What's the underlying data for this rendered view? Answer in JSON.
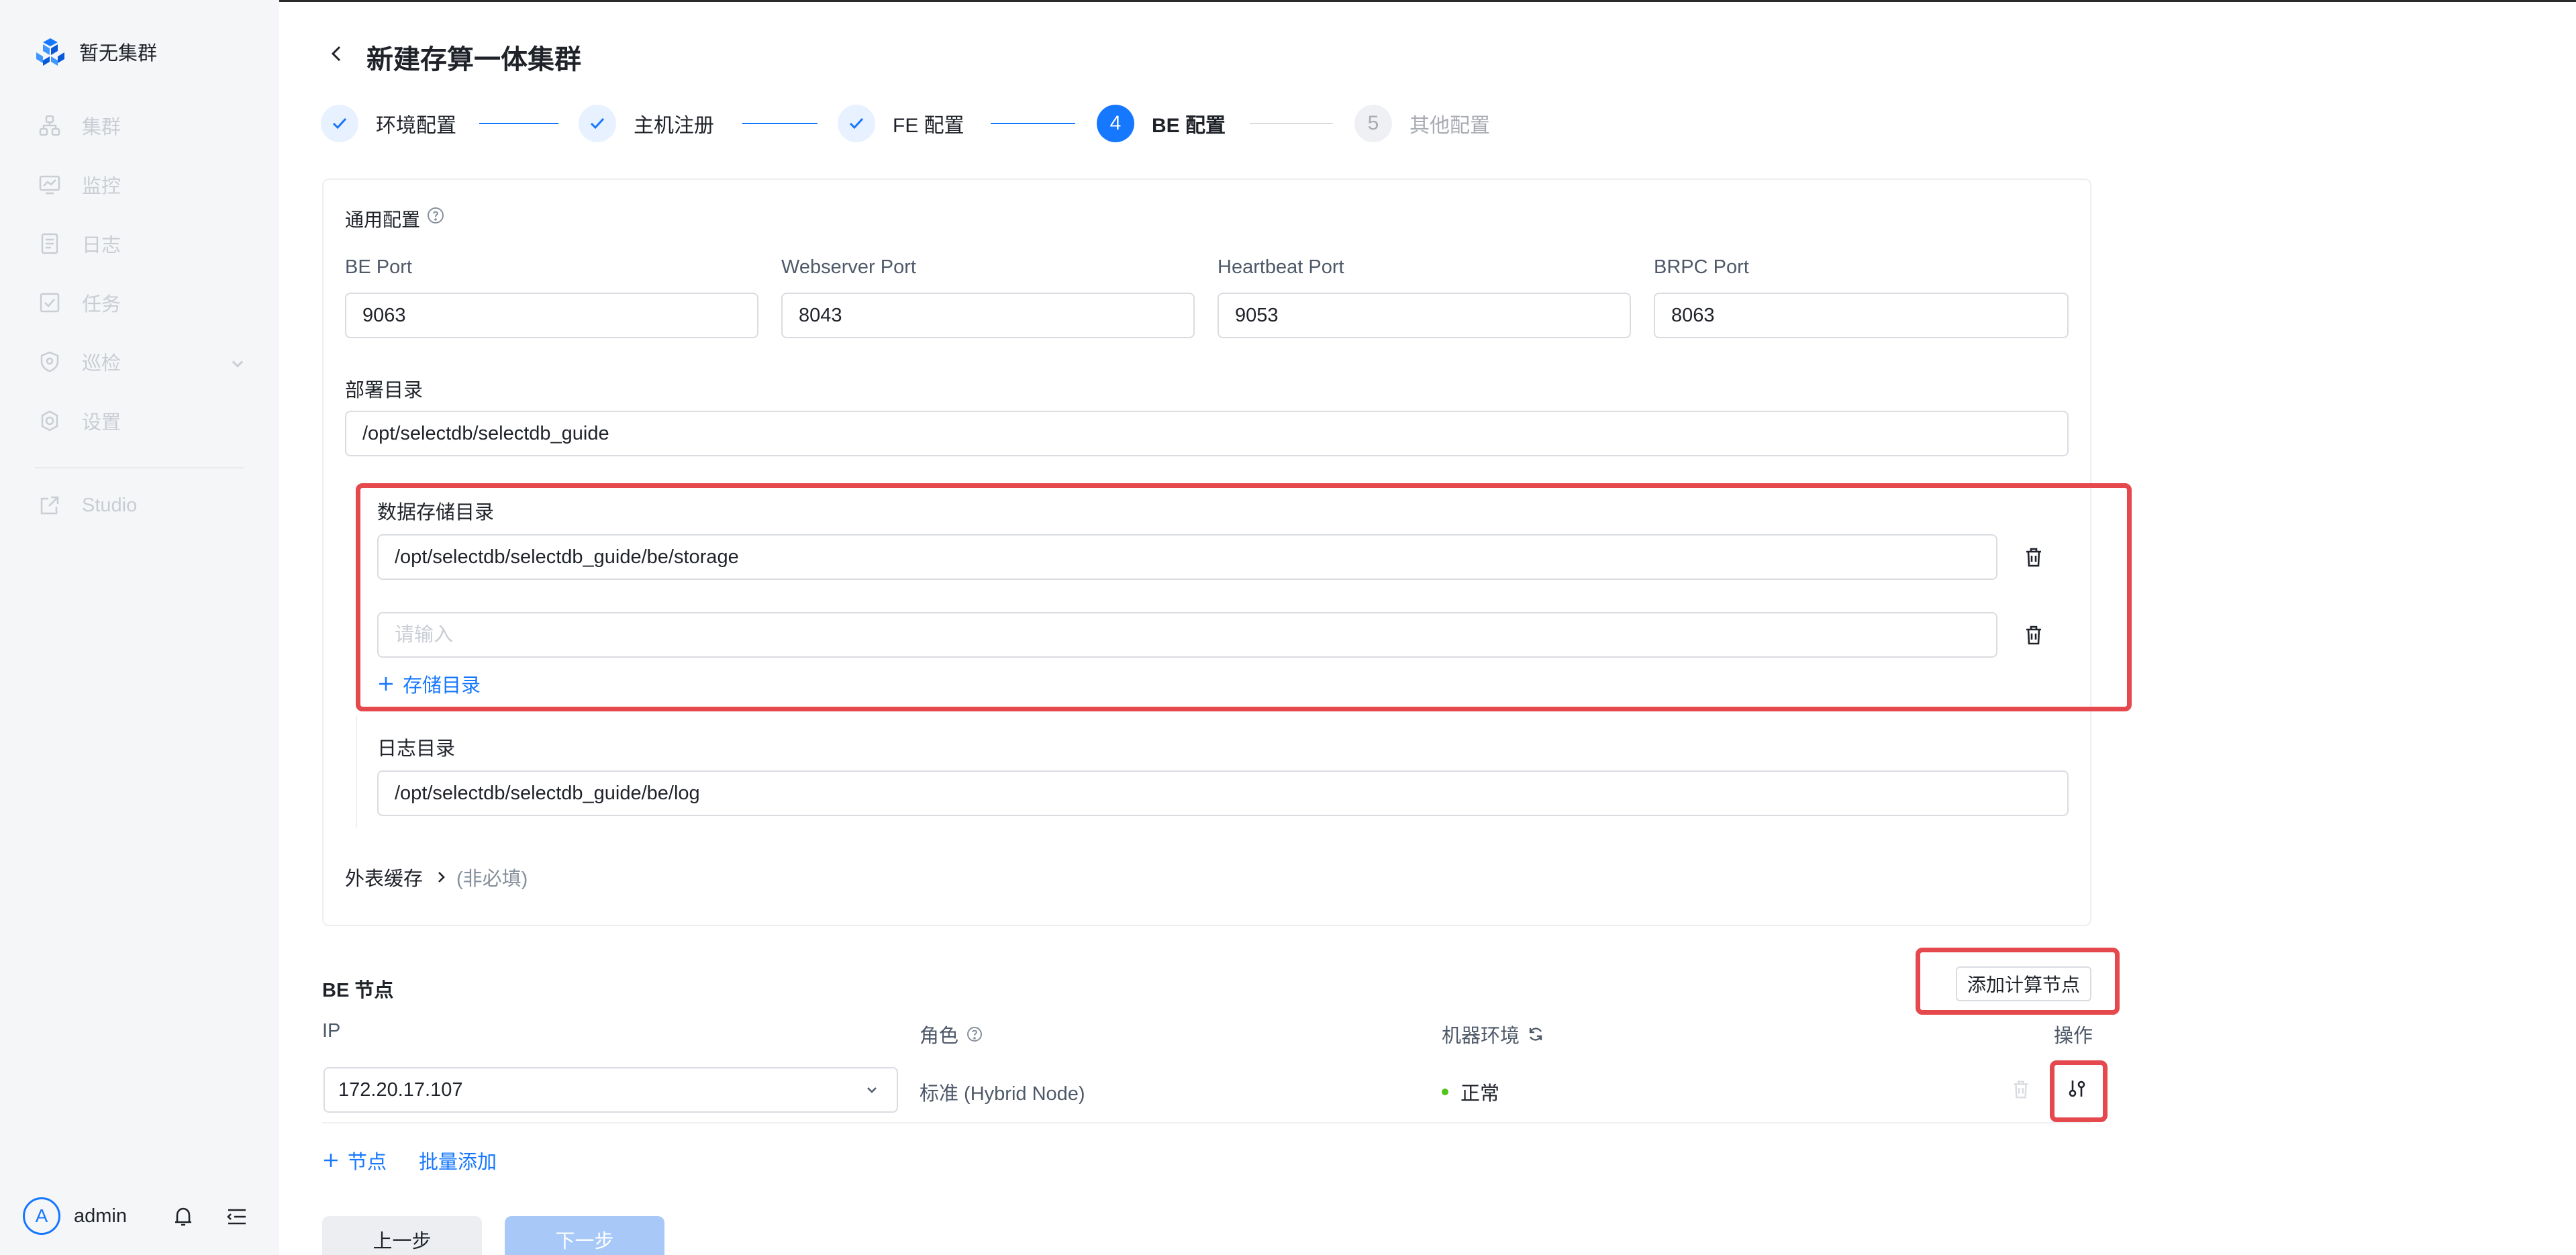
{
  "sidebar": {
    "brand": "暂无集群",
    "items": [
      {
        "label": "集群",
        "icon": "cluster-icon"
      },
      {
        "label": "监控",
        "icon": "monitor-icon"
      },
      {
        "label": "日志",
        "icon": "log-icon"
      },
      {
        "label": "任务",
        "icon": "task-icon"
      },
      {
        "label": "巡检",
        "icon": "inspect-icon"
      },
      {
        "label": "设置",
        "icon": "settings-icon"
      },
      {
        "label": "Studio",
        "icon": "external-link-icon"
      }
    ],
    "user": {
      "initial": "A",
      "name": "admin"
    }
  },
  "header": {
    "title": "新建存算一体集群"
  },
  "steps": [
    {
      "label": "环境配置",
      "state": "done"
    },
    {
      "label": "主机注册",
      "state": "done"
    },
    {
      "label": "FE 配置",
      "state": "done"
    },
    {
      "number": "4",
      "label": "BE 配置",
      "state": "active"
    },
    {
      "number": "5",
      "label": "其他配置",
      "state": "todo"
    }
  ],
  "general": {
    "title": "通用配置",
    "ports": [
      {
        "label": "BE Port",
        "value": "9063"
      },
      {
        "label": "Webserver Port",
        "value": "8043"
      },
      {
        "label": "Heartbeat Port",
        "value": "9053"
      },
      {
        "label": "BRPC Port",
        "value": "8063"
      }
    ],
    "deploy_dir_label": "部署目录",
    "deploy_dir": "/opt/selectdb/selectdb_guide",
    "storage_label": "数据存储目录",
    "storage_dirs": [
      "/opt/selectdb/selectdb_guide/be/storage",
      ""
    ],
    "storage_placeholder": "请输入",
    "add_storage": "存储目录",
    "log_label": "日志目录",
    "log_dir": "/opt/selectdb/selectdb_guide/be/log",
    "external_cache": "外表缓存",
    "external_cache_optional": "(非必填)"
  },
  "be_nodes": {
    "title": "BE 节点",
    "add_compute_button": "添加计算节点",
    "columns": {
      "ip": "IP",
      "role": "角色",
      "env": "机器环境",
      "actions": "操作"
    },
    "rows": [
      {
        "ip": "172.20.17.107",
        "role": "标准 (Hybrid Node)",
        "status": "正常"
      }
    ],
    "add_node": "节点",
    "batch_add": "批量添加"
  },
  "footer": {
    "prev": "上一步",
    "next": "下一步"
  },
  "colors": {
    "primary": "#1677ff",
    "highlight": "#e5484d",
    "ok": "#52c41a"
  }
}
